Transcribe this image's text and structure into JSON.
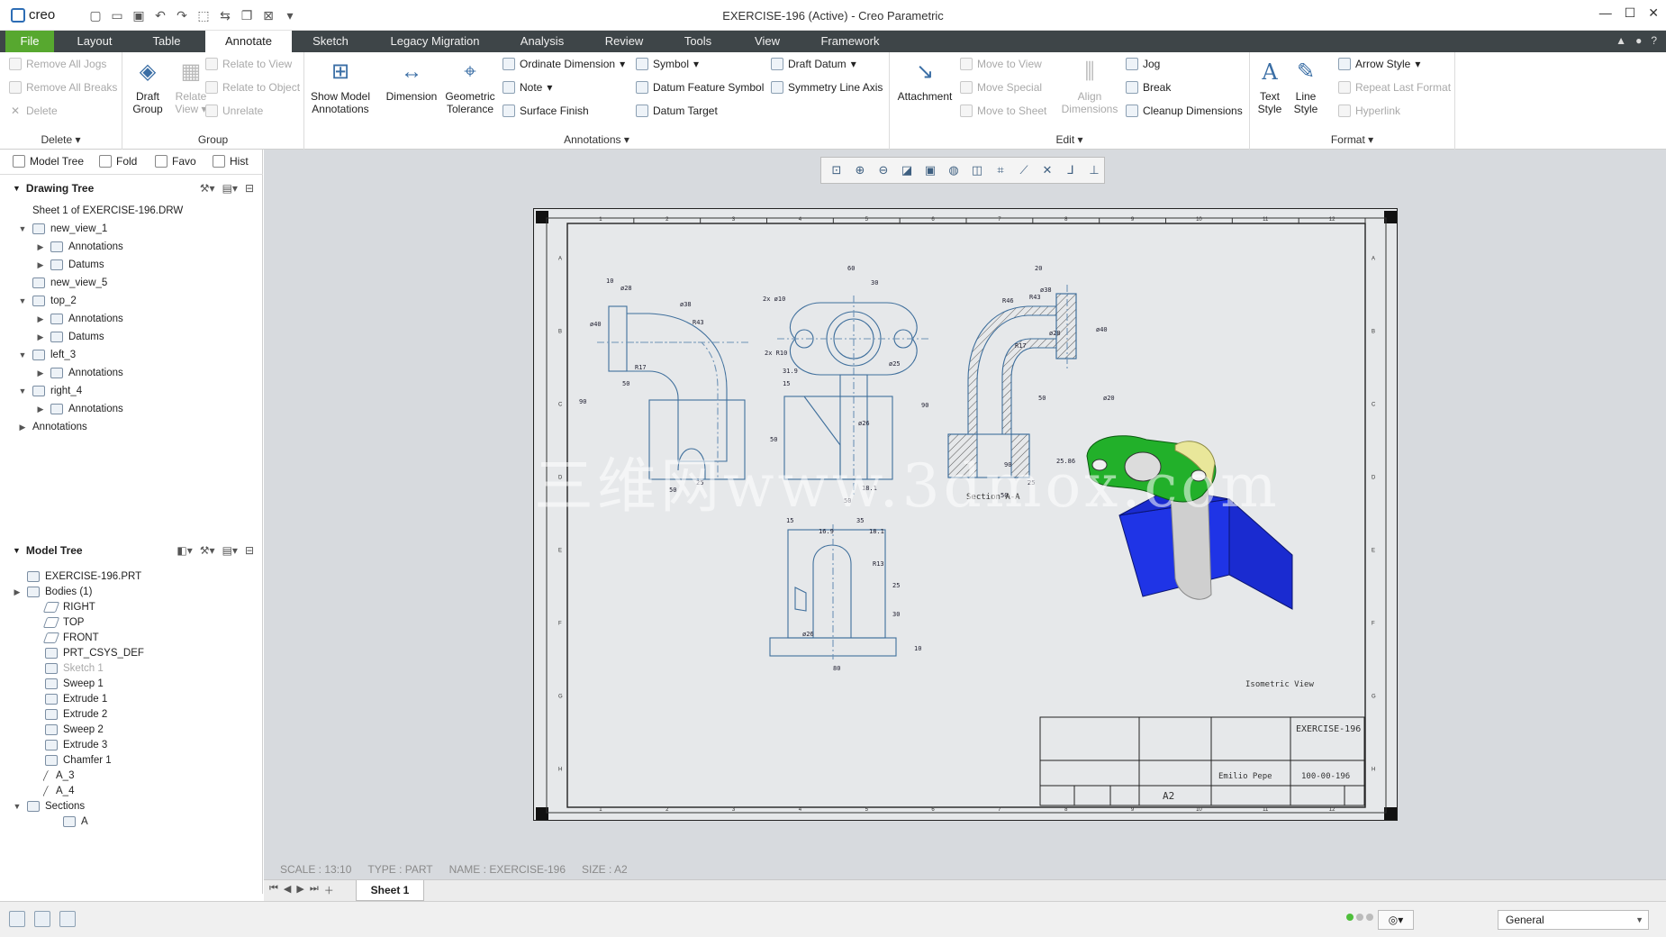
{
  "window": {
    "app_name": "creo",
    "title": "EXERCISE-196 (Active) - Creo Parametric"
  },
  "menu_tabs": [
    "File",
    "Layout",
    "Table",
    "Annotate",
    "Sketch",
    "Legacy Migration",
    "Analysis",
    "Review",
    "Tools",
    "View",
    "Framework"
  ],
  "ribbon": {
    "delete_group": {
      "items": [
        "Remove All Jogs",
        "Remove All Breaks",
        "Delete"
      ],
      "label": "Delete"
    },
    "group_group": {
      "draft_group": "Draft Group",
      "relate_view": "Relate View",
      "items": [
        "Relate to View",
        "Relate to Object",
        "Unrelate"
      ],
      "label": "Group"
    },
    "annotations_group": {
      "show_model_annotations": "Show Model Annotations",
      "dimension": "Dimension",
      "geometric_tolerance": "Geometric Tolerance",
      "col1": [
        "Ordinate Dimension",
        "Note",
        "Surface Finish"
      ],
      "col2": [
        "Symbol",
        "Datum Feature Symbol",
        "Datum Target"
      ],
      "col3": [
        "Draft Datum",
        "Symmetry Line Axis"
      ],
      "label": "Annotations"
    },
    "edit_group": {
      "attachment": "Attachment",
      "col1": [
        "Move to View",
        "Move Special",
        "Move to Sheet"
      ],
      "align_dimensions": "Align Dimensions",
      "col2": [
        "Jog",
        "Break",
        "Cleanup Dimensions"
      ],
      "label": "Edit"
    },
    "format_group": {
      "text_style": "Text Style",
      "line_style": "Line Style",
      "items": [
        "Arrow Style",
        "Repeat Last Format",
        "Hyperlink"
      ],
      "label": "Format"
    }
  },
  "left_panel": {
    "tabs": [
      "Model Tree",
      "Fold",
      "Favo",
      "Hist"
    ],
    "drawing_tree": {
      "header": "Drawing Tree",
      "items": [
        {
          "label": "Sheet 1 of EXERCISE-196.DRW",
          "indent": 0,
          "toggle": ""
        },
        {
          "label": "new_view_1",
          "indent": 0,
          "toggle": "down"
        },
        {
          "label": "Annotations",
          "indent": 1,
          "toggle": "right"
        },
        {
          "label": "Datums",
          "indent": 1,
          "toggle": "right"
        },
        {
          "label": "new_view_5",
          "indent": 0,
          "toggle": ""
        },
        {
          "label": "top_2",
          "indent": 0,
          "toggle": "down"
        },
        {
          "label": "Annotations",
          "indent": 1,
          "toggle": "right"
        },
        {
          "label": "Datums",
          "indent": 1,
          "toggle": "right"
        },
        {
          "label": "left_3",
          "indent": 0,
          "toggle": "down"
        },
        {
          "label": "Annotations",
          "indent": 1,
          "toggle": "right"
        },
        {
          "label": "right_4",
          "indent": 0,
          "toggle": "down"
        },
        {
          "label": "Annotations",
          "indent": 1,
          "toggle": "right"
        },
        {
          "label": "Annotations",
          "indent": -1,
          "toggle": "right"
        }
      ]
    },
    "model_tree": {
      "header": "Model Tree",
      "items": [
        {
          "label": "EXERCISE-196.PRT",
          "toggle": "",
          "dim": false
        },
        {
          "label": "Bodies (1)",
          "toggle": "right",
          "dim": false
        },
        {
          "label": "RIGHT",
          "toggle": "",
          "dim": false
        },
        {
          "label": "TOP",
          "toggle": "",
          "dim": false
        },
        {
          "label": "FRONT",
          "toggle": "",
          "dim": false
        },
        {
          "label": "PRT_CSYS_DEF",
          "toggle": "",
          "dim": false
        },
        {
          "label": "Sketch 1",
          "toggle": "",
          "dim": true
        },
        {
          "label": "Sweep 1",
          "toggle": "",
          "dim": false
        },
        {
          "label": "Extrude 1",
          "toggle": "",
          "dim": false
        },
        {
          "label": "Extrude 2",
          "toggle": "",
          "dim": false
        },
        {
          "label": "Sweep 2",
          "toggle": "",
          "dim": false
        },
        {
          "label": "Extrude 3",
          "toggle": "",
          "dim": false
        },
        {
          "label": "Chamfer 1",
          "toggle": "",
          "dim": false
        },
        {
          "label": "A_3",
          "toggle": "",
          "dim": false
        },
        {
          "label": "A_4",
          "toggle": "",
          "dim": false
        },
        {
          "label": "Sections",
          "toggle": "down",
          "dim": false
        },
        {
          "label": "A",
          "toggle": "",
          "dim": false
        }
      ]
    }
  },
  "drawing": {
    "watermark": "三维网www.3dmox.com",
    "section_label": "Section A-A",
    "isometric_label": "Isometric View",
    "title_block": {
      "part_name": "EXERCISE-196",
      "size": "A2",
      "number": "100-00-196",
      "company": "Emilio Pepe"
    },
    "dims": {
      "front": [
        "10",
        "ø28",
        "ø40",
        "ø38",
        "R43",
        "R17",
        "50",
        "90",
        "50",
        "25"
      ],
      "top": [
        "60",
        "30",
        "2x ø10",
        "2x R10",
        "ø25",
        "31.9",
        "15",
        "ø26",
        "50",
        "90",
        "18.1",
        "50"
      ],
      "side": [
        "20",
        "ø38",
        "R46",
        "R43",
        "ø28",
        "R17",
        "ø40",
        "50",
        "90",
        "ø20",
        "25",
        "25.86",
        "50"
      ],
      "bottom": [
        "15",
        "35",
        "16.9",
        "18.1",
        "R13",
        "25",
        "30",
        "ø26",
        "10",
        "80"
      ]
    }
  },
  "status_info": {
    "scale": "SCALE : 13:10",
    "type": "TYPE : PART",
    "name": "NAME : EXERCISE-196",
    "size": "SIZE : A2"
  },
  "sheet_tab": "Sheet 1",
  "statusbar": {
    "filter": "General"
  },
  "colors": {
    "file_tab": "#57a82f",
    "tab_bar": "#3e4548",
    "drawing_line": "#3f6f9c",
    "iso_green": "#22b02a",
    "iso_blue": "#1a2bd0",
    "iso_yellow": "#e9e79a"
  }
}
